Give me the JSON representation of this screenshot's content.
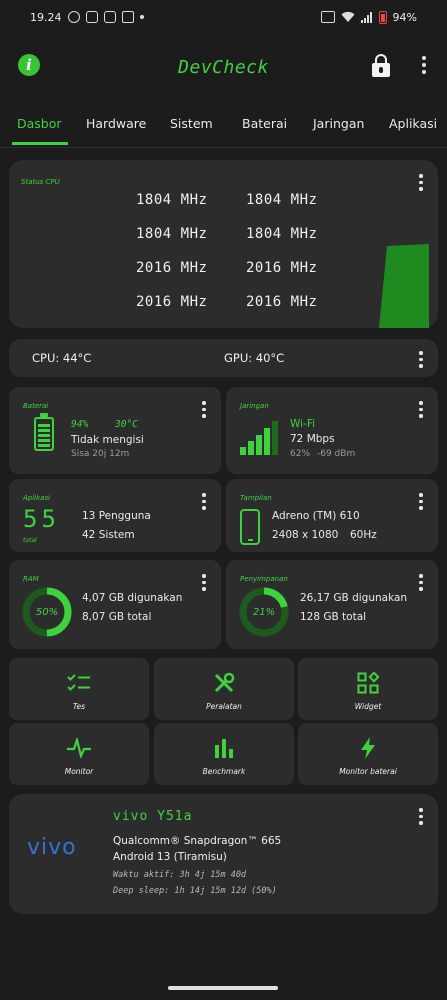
{
  "status_bar": {
    "time": "19.24",
    "battery_pct": "94%"
  },
  "app": {
    "title": "DevCheck"
  },
  "tabs": [
    "Dasbor",
    "Hardware",
    "Sistem",
    "Baterai",
    "Jaringan",
    "Aplikasi"
  ],
  "cpu": {
    "label": "Status CPU",
    "freqs": [
      "1804 MHz",
      "1804 MHz",
      "1804 MHz",
      "1804 MHz",
      "2016 MHz",
      "2016 MHz",
      "2016 MHz",
      "2016 MHz"
    ]
  },
  "temps": {
    "cpu": "CPU: 44°C",
    "gpu": "GPU: 40°C"
  },
  "battery": {
    "label": "Baterai",
    "level": "94%",
    "temp": "30°C",
    "status": "Tidak mengisi",
    "remaining": "Sisa 20j 12m",
    "fill_fraction": 0.94
  },
  "network": {
    "label": "Jaringan",
    "type": "Wi-Fi",
    "speed": "72 Mbps",
    "signal": "62%",
    "dbm": "-69 dBm"
  },
  "apps": {
    "label": "Aplikasi",
    "total": "55",
    "total_caption": "total",
    "user": "13 Pengguna",
    "system": "42 Sistem"
  },
  "display": {
    "label": "Tampilan",
    "gpu": "Adreno (TM) 610",
    "resolution": "2408 x 1080",
    "refresh": "60Hz"
  },
  "ram": {
    "label": "RAM",
    "percent": "50%",
    "used": "4,07 GB digunakan",
    "total": "8,07 GB total",
    "fraction": 0.5
  },
  "storage": {
    "label": "Penyimpanan",
    "percent": "21%",
    "used": "26,17 GB digunakan",
    "total": "128 GB total",
    "fraction": 0.21
  },
  "tools": [
    "Tes",
    "Peralatan",
    "Widget",
    "Monitor",
    "Benchmark",
    "Monitor baterai"
  ],
  "device": {
    "brand": "vivo",
    "name": "vivo Y51a",
    "soc": "Qualcomm® Snapdragon™ 665",
    "android": "Android 13 (Tiramisu)",
    "uptime": "Waktu aktif: 3h 4j 15m 40d",
    "deep_sleep": "Deep sleep: 1h 14j 15m 12d (50%)"
  },
  "colors": {
    "accent": "#3fd23f",
    "background": "#1c1c1c",
    "card": "#2c2c2c",
    "vivo_blue": "#3a6fd8"
  }
}
